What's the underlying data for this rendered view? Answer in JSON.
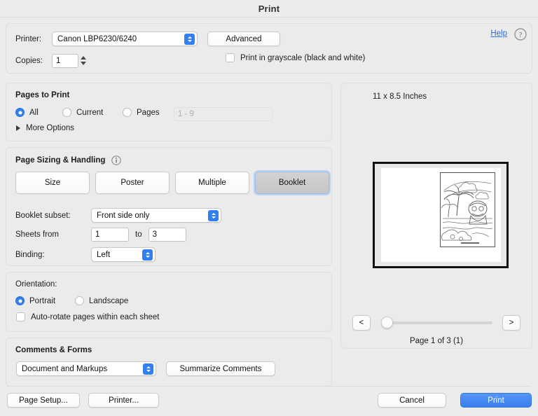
{
  "window": {
    "title": "Print"
  },
  "help": {
    "label": "Help",
    "icon": "question-mark-circle-icon"
  },
  "printer": {
    "label": "Printer:",
    "selected": "Canon LBP6230/6240",
    "advanced_label": "Advanced"
  },
  "copies": {
    "label": "Copies:",
    "value": "1"
  },
  "grayscale": {
    "label": "Print in grayscale (black and white)",
    "checked": false
  },
  "pages_to_print": {
    "title": "Pages to Print",
    "options": [
      {
        "label": "All",
        "selected": true
      },
      {
        "label": "Current",
        "selected": false
      },
      {
        "label": "Pages",
        "selected": false
      }
    ],
    "range_placeholder": "1 - 9",
    "range_value": "",
    "more_options_label": "More Options"
  },
  "page_sizing": {
    "title": "Page Sizing & Handling",
    "info_icon": "info-circle-icon",
    "modes": [
      {
        "label": "Size",
        "selected": false
      },
      {
        "label": "Poster",
        "selected": false
      },
      {
        "label": "Multiple",
        "selected": false
      },
      {
        "label": "Booklet",
        "selected": true
      }
    ],
    "booklet_subset": {
      "label": "Booklet subset:",
      "value": "Front side only"
    },
    "sheets": {
      "from_label": "Sheets from",
      "from_value": "1",
      "to_label": "to",
      "to_value": "3"
    },
    "binding": {
      "label": "Binding:",
      "value": "Left"
    }
  },
  "orientation": {
    "title": "Orientation:",
    "options": [
      {
        "label": "Portrait",
        "selected": true
      },
      {
        "label": "Landscape",
        "selected": false
      }
    ],
    "auto_rotate": {
      "label": "Auto-rotate pages within each sheet",
      "checked": false
    }
  },
  "comments_forms": {
    "title": "Comments & Forms",
    "selected": "Document and Markups",
    "summarize_label": "Summarize Comments"
  },
  "preview": {
    "paper_size": "11 x 8.5 Inches",
    "page_indicator": "Page 1 of 3 (1)",
    "prev_label": "<",
    "next_label": ">",
    "zoom_value": 0
  },
  "footer": {
    "page_setup_label": "Page Setup...",
    "printer_label": "Printer...",
    "cancel_label": "Cancel",
    "print_label": "Print"
  },
  "colors": {
    "accent": "#307ff4",
    "print_button": "#3a7ef0",
    "link": "#2f6fd6",
    "panel_bg": "#ebebeb",
    "window_bg": "#ececec"
  }
}
